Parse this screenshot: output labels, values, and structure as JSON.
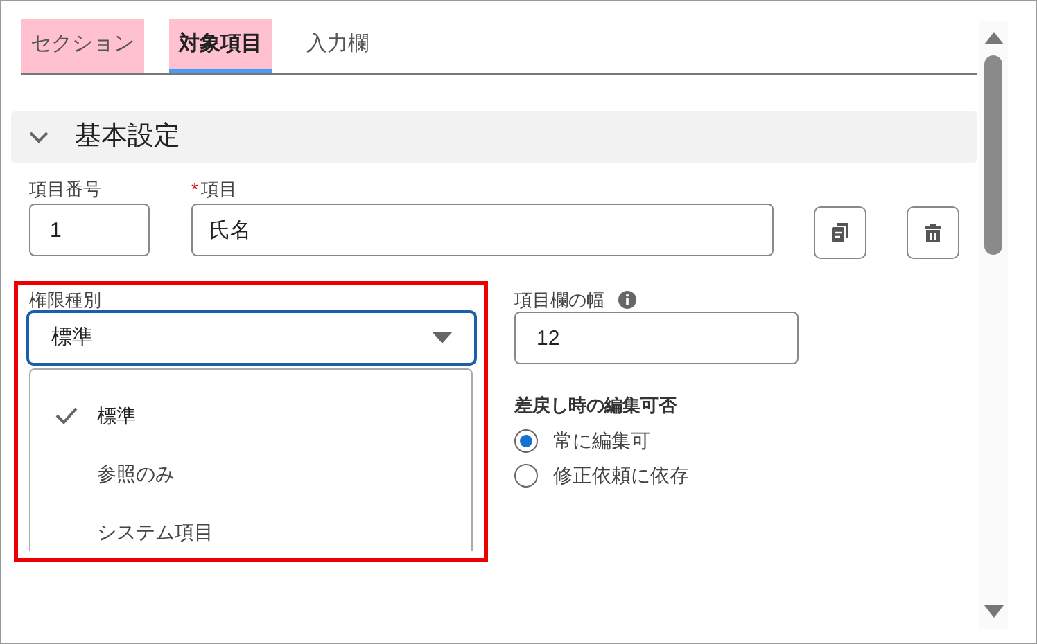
{
  "tabs": [
    {
      "label": "セクション",
      "selected": false,
      "highlighted": true
    },
    {
      "label": "対象項目",
      "selected": true,
      "highlighted": true
    },
    {
      "label": "入力欄",
      "selected": false,
      "highlighted": false
    }
  ],
  "section": {
    "title": "基本設定",
    "expanded": true
  },
  "item_number": {
    "label": "項目番号",
    "value": "1"
  },
  "item": {
    "label": "項目",
    "required_mark": "*",
    "value": "氏名"
  },
  "permission": {
    "label": "権限種別",
    "value": "標準",
    "expanded": true,
    "options": [
      {
        "label": "標準",
        "selected": true
      },
      {
        "label": "参照のみ",
        "selected": false
      },
      {
        "label": "システム項目",
        "selected": false
      }
    ]
  },
  "width_field": {
    "label": "項目欄の幅",
    "value": "12"
  },
  "edit_on_return": {
    "label": "差戻し時の編集可否",
    "options": [
      {
        "label": "常に編集可",
        "selected": true
      },
      {
        "label": "修正依頼に依存",
        "selected": false
      }
    ]
  }
}
